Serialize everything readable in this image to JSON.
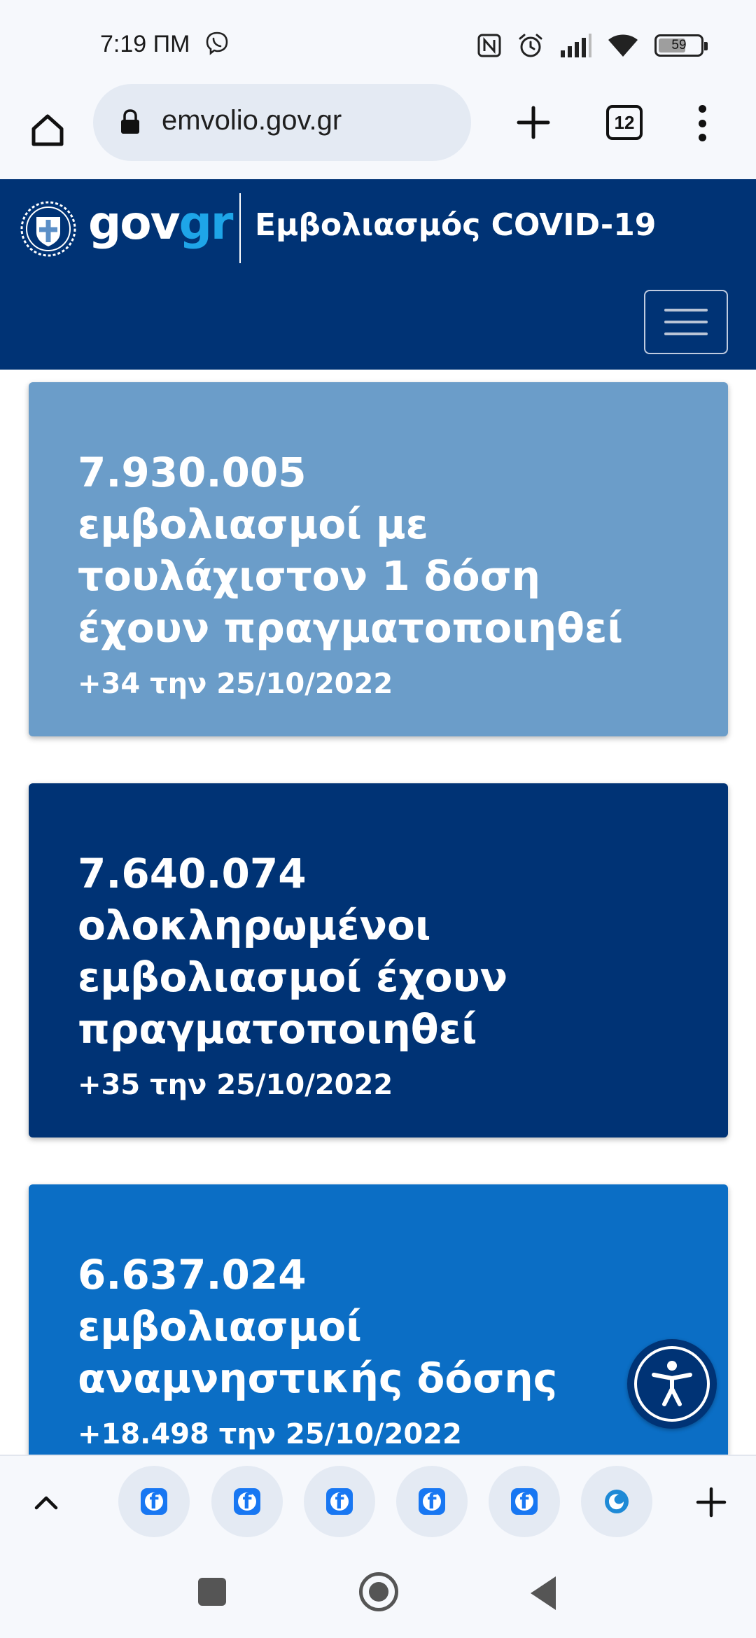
{
  "status_bar": {
    "time": "7:19 ΠΜ",
    "battery_level": "59",
    "icons": [
      "viber-icon",
      "nfc-icon",
      "alarm-icon",
      "signal-icon",
      "wifi-icon",
      "battery-icon"
    ]
  },
  "browser": {
    "url": "emvolio.gov.gr",
    "tab_count": "12",
    "icons": [
      "home-icon",
      "lock-icon",
      "plus-icon",
      "tabs-icon",
      "more-vert-icon"
    ]
  },
  "header": {
    "logo_gov": "gov",
    "logo_gr": "gr",
    "title": "Εμβολιασμός COVID-19"
  },
  "cards": [
    {
      "number": "7.930.005",
      "description_lines": [
        "εμβολιασμοί με",
        "τουλάχιστον 1 δόση",
        "έχουν πραγματοποιηθεί"
      ],
      "delta": "+34 την 25/10/2022",
      "color": "#6b9dc9"
    },
    {
      "number": "7.640.074",
      "description_lines": [
        "ολοκληρωμένοι",
        "εμβολιασμοί έχουν",
        "πραγματοποιηθεί"
      ],
      "delta": "+35 την 25/10/2022",
      "color": "#003375"
    },
    {
      "number": "6.637.024",
      "description_lines": [
        "εμβολιασμοί",
        "αναμνηστικής δόσης"
      ],
      "delta": "+18.498 την 25/10/2022",
      "color": "#0b6ec5"
    }
  ],
  "tab_strip": {
    "tabs": [
      "facebook-icon",
      "facebook-icon",
      "facebook-icon",
      "facebook-icon",
      "facebook-icon",
      "site-favicon-icon"
    ]
  },
  "colors": {
    "header_bg": "#003375",
    "logo_accent": "#1ea5e8",
    "toolbar_bg": "#f6f8fc"
  }
}
